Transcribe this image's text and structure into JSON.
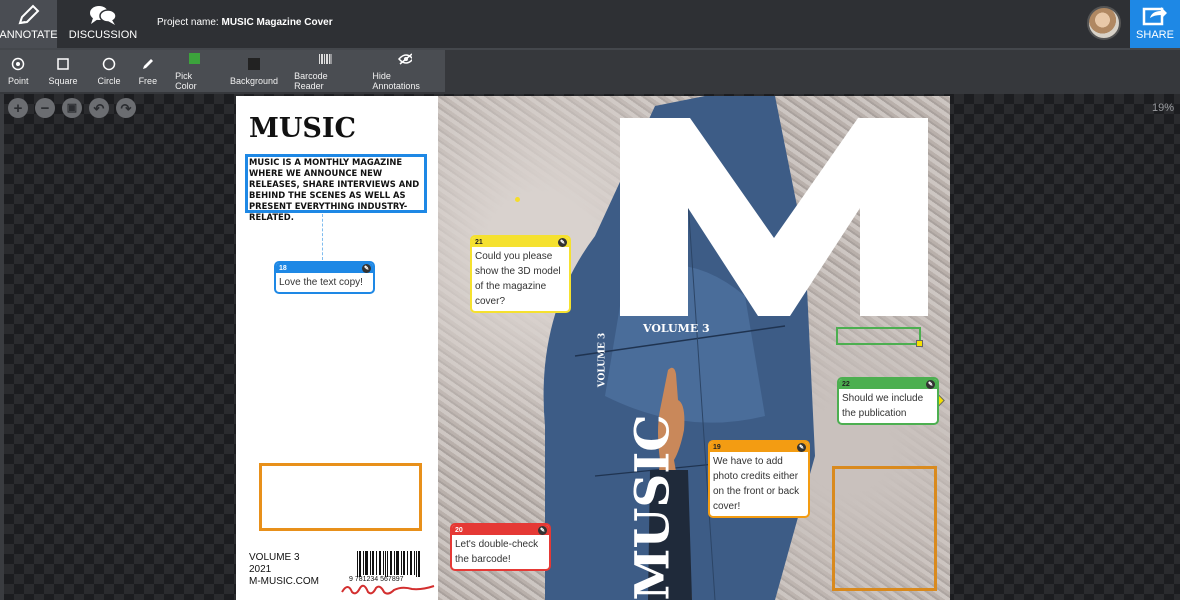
{
  "header": {
    "modes": [
      {
        "label": "ANNOTATE",
        "icon": "pencil-icon",
        "active": true
      },
      {
        "label": "DISCUSSION",
        "icon": "chat-bubbles-icon",
        "active": false
      }
    ],
    "project_label": "Project name:",
    "project_name": "MUSIC Magazine Cover",
    "share_label": "SHARE"
  },
  "toolbar": {
    "tools": [
      {
        "label": "Point",
        "icon": "point-icon"
      },
      {
        "label": "Square",
        "icon": "square-icon"
      },
      {
        "label": "Circle",
        "icon": "circle-icon"
      },
      {
        "label": "Free",
        "icon": "freehand-pen-icon"
      },
      {
        "label": "Pick Color",
        "icon": "color-swatch-icon"
      },
      {
        "label": "Background",
        "icon": "background-swatch-icon"
      },
      {
        "label": "Barcode Reader",
        "icon": "barcode-icon"
      },
      {
        "label": "Hide Annotations",
        "icon": "eye-off-icon"
      }
    ],
    "pick_color": "#3ca33c",
    "background_color": "#222222"
  },
  "canvas": {
    "zoom_controls": [
      "+",
      "−",
      "▣",
      "↶",
      "↷"
    ],
    "zoom_level": "19%"
  },
  "cover": {
    "back": {
      "title": "MUSIC",
      "blurb": "MUSIC IS A MONTHLY MAGAZINE WHERE WE ANNOUNCE NEW RELEASES, SHARE INTERVIEWS AND BEHIND THE SCENES AS WELL AS PRESENT EVERYTHING INDUSTRY-RELATED.",
      "volume": "VOLUME 3",
      "year": "2021",
      "website": "M-MUSIC.COM",
      "barcode_number": "9  781234  567897"
    },
    "front": {
      "big_letter": "M",
      "volume": "VOLUME 3",
      "spine_title": "MUSIC",
      "spine_volume": "VOLUME 3"
    }
  },
  "comments": [
    {
      "id": "18",
      "text": "Love the text copy!",
      "color": "#1e88e5"
    },
    {
      "id": "21",
      "text": "Could you please show the 3D model of the magazine cover?",
      "color": "#f5e12f"
    },
    {
      "id": "22",
      "text": "Should we include the publication date?",
      "color": "#4caf50"
    },
    {
      "id": "19",
      "text": "We have to add photo credits either on the front or back cover!",
      "color": "#f39c12"
    },
    {
      "id": "20",
      "text": "Let's double-check the barcode!",
      "color": "#e53935"
    }
  ]
}
